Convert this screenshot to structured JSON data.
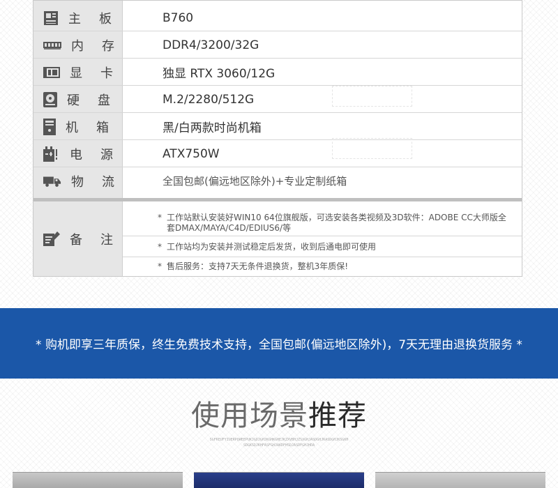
{
  "specs": [
    {
      "icon": "motherboard-icon",
      "label": "主板",
      "value": "B760"
    },
    {
      "icon": "memory-icon",
      "label": "内存",
      "value": "DDR4/3200/32G"
    },
    {
      "icon": "graphics-card-icon",
      "label": "显卡",
      "value": "独显 RTX 3060/12G"
    },
    {
      "icon": "hard-disk-icon",
      "label": "硬盘",
      "value": "M.2/2280/512G"
    },
    {
      "icon": "case-icon",
      "label": "机箱",
      "value": "黑/白两款时尚机箱"
    },
    {
      "icon": "power-supply-icon",
      "label": "电源",
      "value": "ATX750W"
    },
    {
      "icon": "truck-icon",
      "label": "物流",
      "value": "全国包邮(偏远地区除外)+专业定制纸箱"
    }
  ],
  "notes": {
    "icon": "edit-icon",
    "label": "备注",
    "items": [
      {
        "star": "*",
        "text": "工作站默认安装好WIN10 64位旗舰版，可选安装各类视频及3D软件：ADOBE CC大师版全套DMAX/MAYA/C4D/EDIUS6/等"
      },
      {
        "star": "*",
        "text": "工作站均为安装并测试稳定后发货，收到后通电即可使用"
      },
      {
        "star": "*",
        "text": "售后服务：支持7天无条件退换货，整机3年质保!"
      }
    ]
  },
  "banner": {
    "text": "* 购机即享三年质保，终生免费技术支持，全国包邮(偏远地区除外)，7天无理由退换货服务 *",
    "color": "#1b57a8"
  },
  "section": {
    "title_light": "使用场景",
    "title_bold": "推荐",
    "sub_line_1": "SGFKEUFYIUERPQWEEPUKJGDJGHJKGHKGHEJKZXVBHJZSXGHJASDGHJKASDGHJKSGKH",
    "sub_line_2": "SDGKSDJKHFASFGHJAKDFHSDJASDFGHJHDA"
  }
}
